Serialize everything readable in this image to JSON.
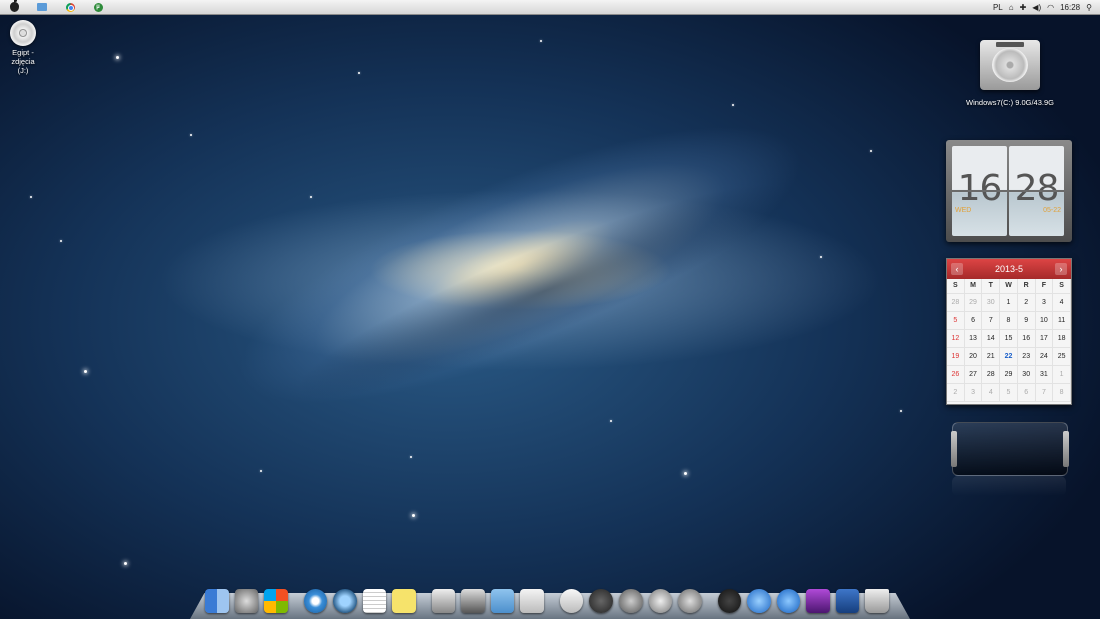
{
  "menubar": {
    "left_icons": [
      "apple-icon",
      "finder-folder-icon",
      "chrome-icon",
      "utorrent-icon"
    ],
    "lang": "PL",
    "time": "16:28"
  },
  "desktop": {
    "dvd_label": "Egipt - zdjęcia",
    "dvd_drive": "(J:)",
    "hdd_label": "Windows7(C:)  9.0G/43.9G"
  },
  "clock": {
    "hours": "16",
    "minutes": "28",
    "weekday": "WED",
    "date": "05-22"
  },
  "calendar": {
    "title": "2013-5",
    "prev": "‹",
    "next": "›",
    "weekdays": [
      "S",
      "M",
      "T",
      "W",
      "R",
      "F",
      "S"
    ],
    "weeks": [
      [
        "28",
        "29",
        "30",
        "1",
        "2",
        "3",
        "4"
      ],
      [
        "5",
        "6",
        "7",
        "8",
        "9",
        "10",
        "11"
      ],
      [
        "12",
        "13",
        "14",
        "15",
        "16",
        "17",
        "18"
      ],
      [
        "19",
        "20",
        "21",
        "22",
        "23",
        "24",
        "25"
      ],
      [
        "26",
        "27",
        "28",
        "29",
        "30",
        "31",
        "1"
      ],
      [
        "2",
        "3",
        "4",
        "5",
        "6",
        "7",
        "8"
      ]
    ],
    "today": "22"
  },
  "dock": {
    "items": [
      "finder-icon",
      "system-preferences-icon",
      "windows-apps-icon",
      "safari-icon",
      "spotlight-search-icon",
      "textedit-icon",
      "stickies-icon",
      "app-store-icon",
      "disk-utility-icon",
      "folder-icon",
      "share-icon",
      "icloud-icon",
      "power-icon",
      "twitter-icon",
      "photo-booth-icon",
      "rocket-icon",
      "dashboard-icon",
      "itunes-icon",
      "appstore-icon",
      "nasa-wallpaper-icon",
      "display-icon",
      "trash-icon"
    ]
  }
}
